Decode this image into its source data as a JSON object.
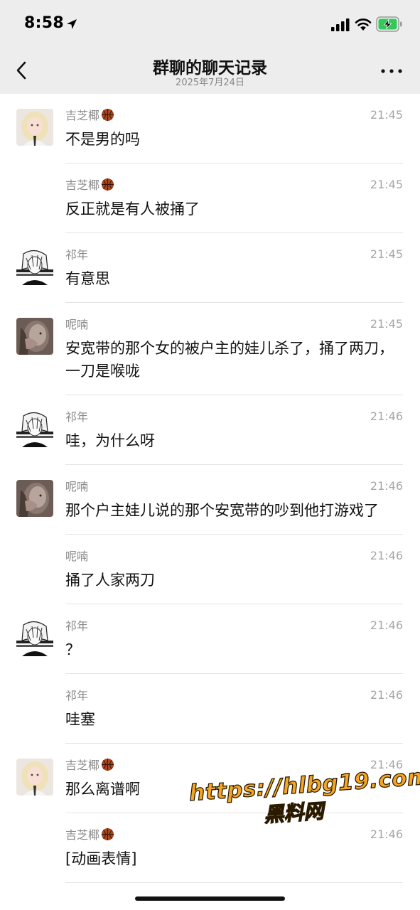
{
  "status_bar": {
    "time": "8:58",
    "battery_color": "#34c759"
  },
  "nav": {
    "title": "群聊的聊天记录",
    "subtitle": "2025年7月24日",
    "back_icon": "chevron-left-icon",
    "more_icon": "ellipsis-icon"
  },
  "messages": [
    {
      "sender": "吉芝椰",
      "sender_emoji": "basketball-emoji",
      "time": "21:45",
      "text": "不是男的吗",
      "avatar": "jizhiye-avatar"
    },
    {
      "sender": "吉芝椰",
      "sender_emoji": "basketball-emoji",
      "time": "21:45",
      "text": "反正就是有人被捅了"
    },
    {
      "sender": "祁年",
      "time": "21:45",
      "text": "有意思",
      "avatar": "qinian-avatar"
    },
    {
      "sender": "呢喃",
      "time": "21:45",
      "text": "安宽带的那个女的被户主的娃儿杀了，捅了两刀，一刀是喉咙",
      "avatar": "ninan-avatar"
    },
    {
      "sender": "祁年",
      "time": "21:46",
      "text": "哇，为什么呀",
      "avatar": "qinian-avatar"
    },
    {
      "sender": "呢喃",
      "time": "21:46",
      "text": "那个户主娃儿说的那个安宽带的吵到他打游戏了",
      "avatar": "ninan-avatar"
    },
    {
      "sender": "呢喃",
      "time": "21:46",
      "text": "捅了人家两刀"
    },
    {
      "sender": "祁年",
      "time": "21:46",
      "text": "？",
      "avatar": "qinian-avatar"
    },
    {
      "sender": "祁年",
      "time": "21:46",
      "text": "哇塞"
    },
    {
      "sender": "吉芝椰",
      "sender_emoji": "basketball-emoji",
      "time": "21:46",
      "text": "那么离谱啊",
      "avatar": "jizhiye-avatar"
    },
    {
      "sender": "吉芝椰",
      "sender_emoji": "basketball-emoji",
      "time": "21:46",
      "text": "[动画表情]"
    }
  ],
  "watermark": {
    "url": "https://hlbg19.com",
    "name": "黑料网",
    "color": "#f5a623"
  }
}
